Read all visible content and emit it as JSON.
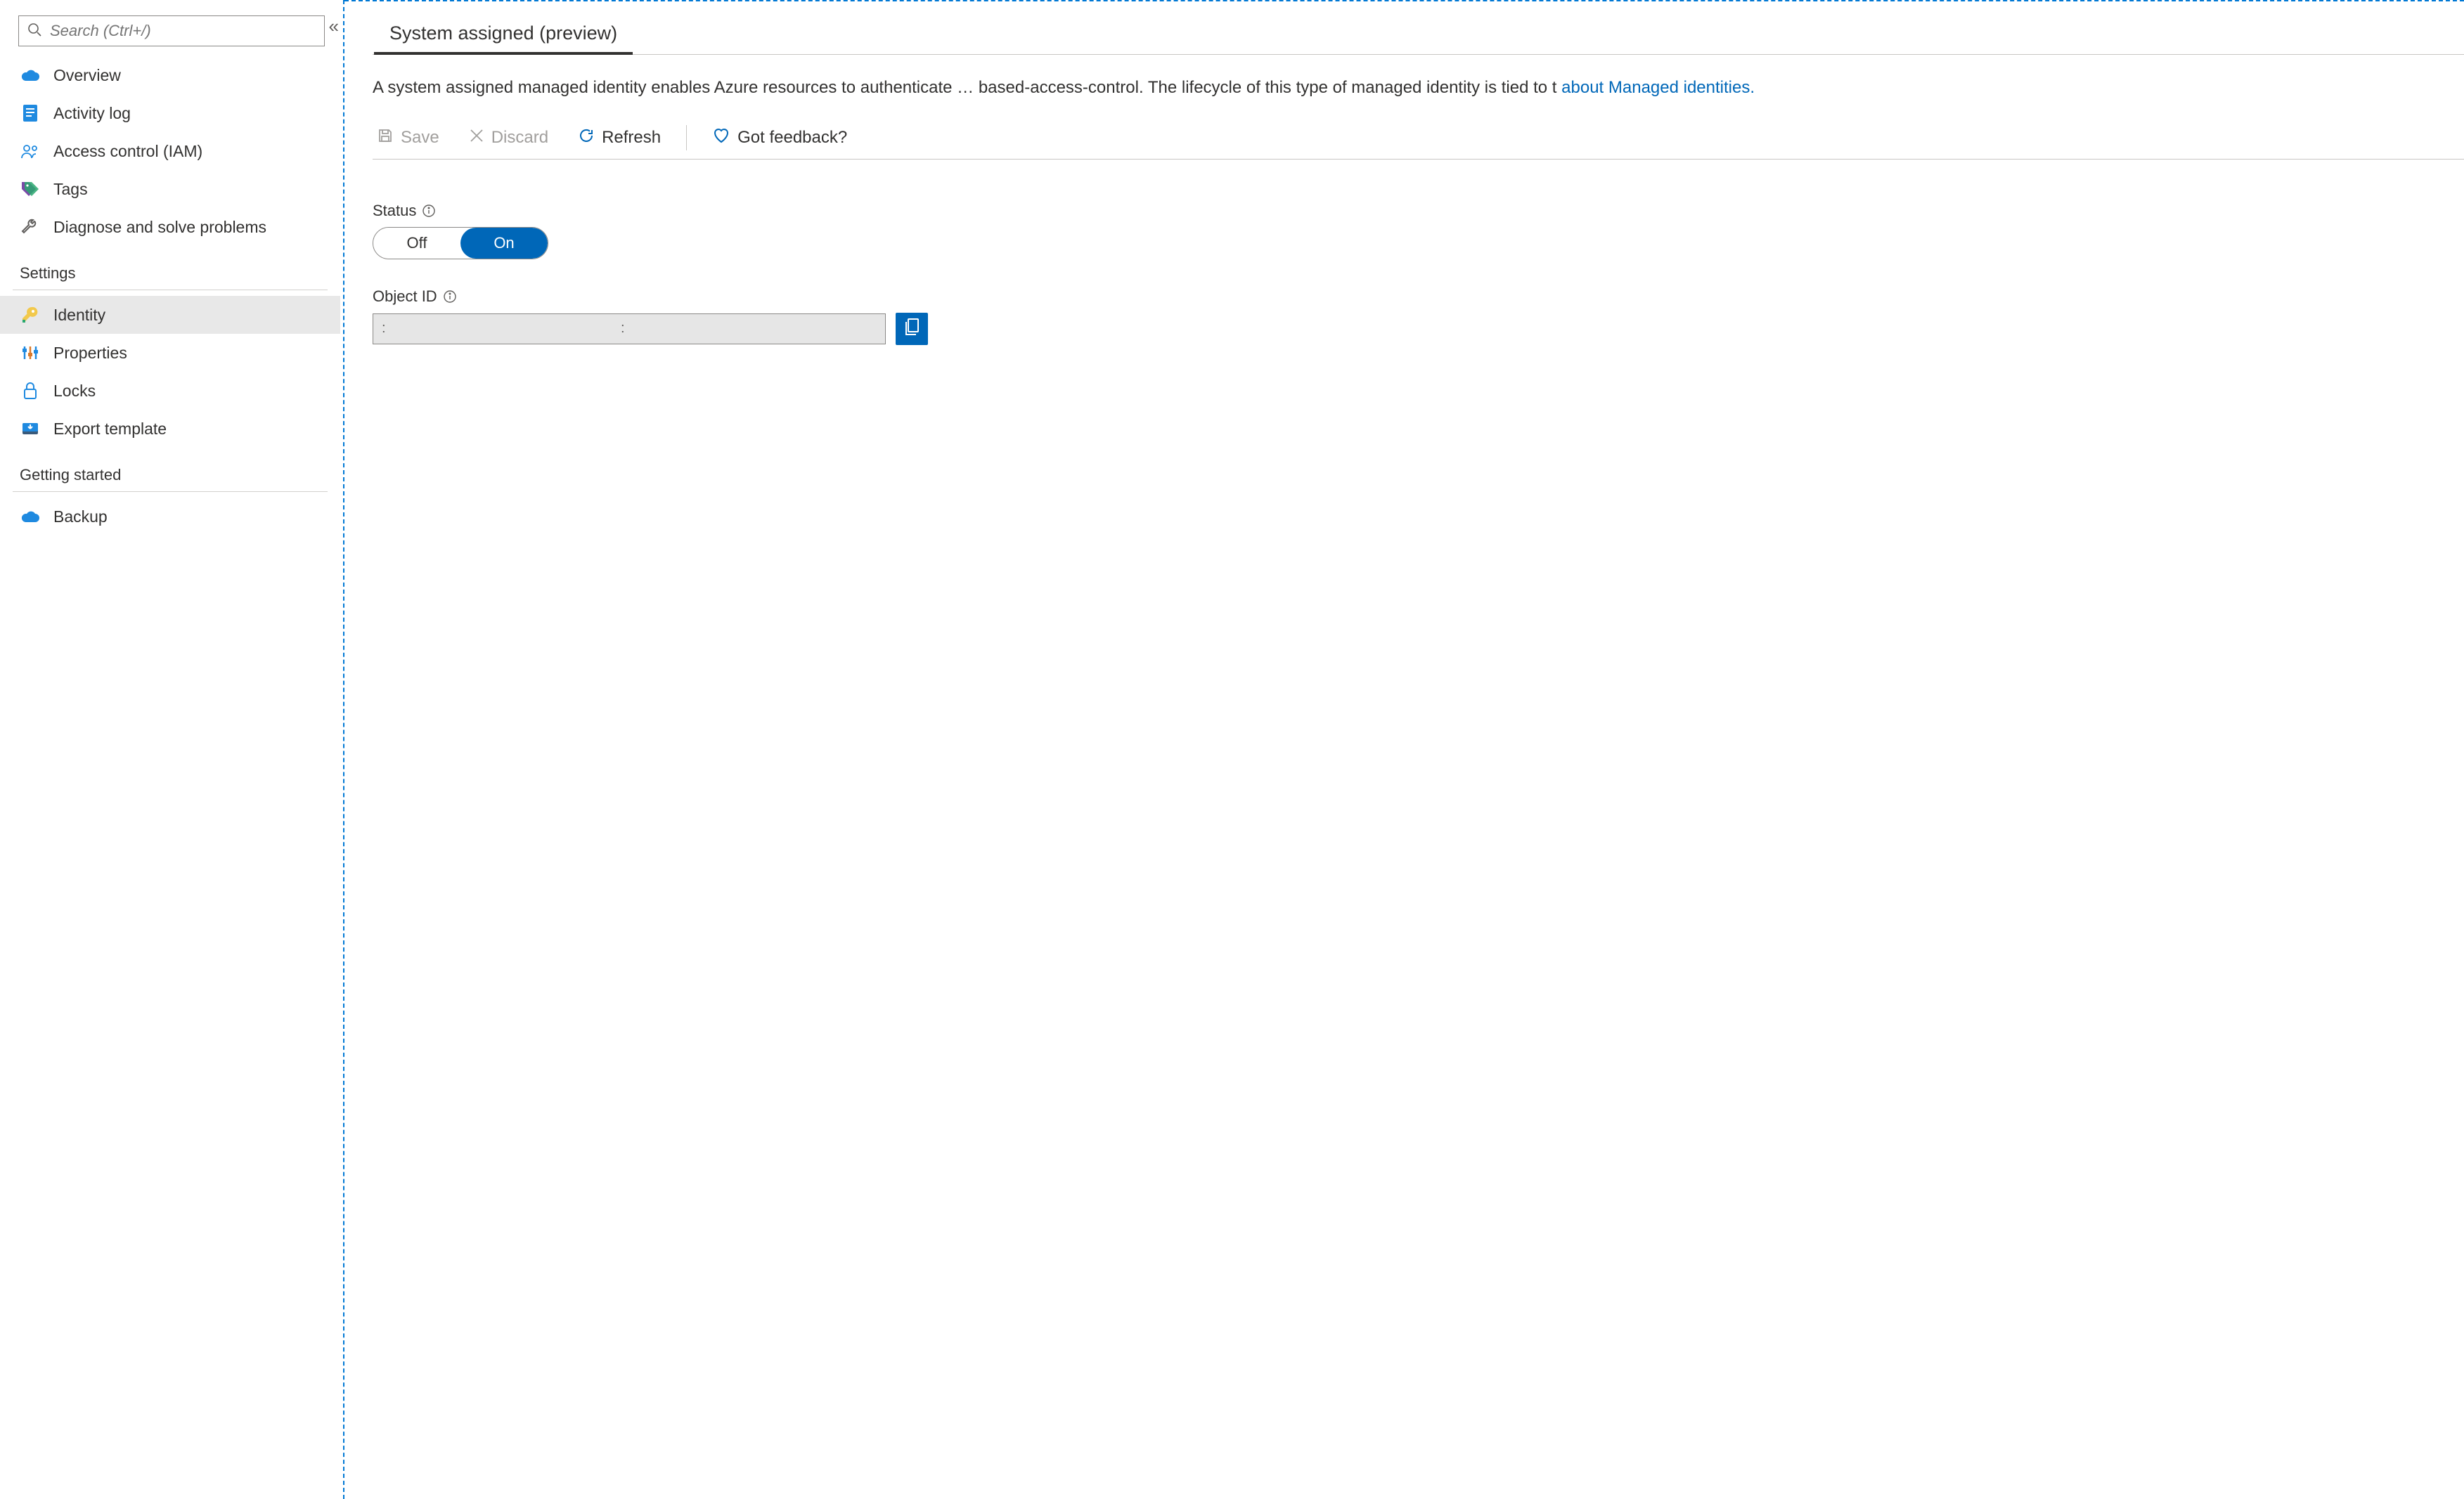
{
  "sidebar": {
    "search_placeholder": "Search (Ctrl+/)",
    "items_top": [
      {
        "icon": "cloud-icon",
        "label": "Overview"
      },
      {
        "icon": "log-icon",
        "label": "Activity log"
      },
      {
        "icon": "people-icon",
        "label": "Access control (IAM)"
      },
      {
        "icon": "tags-icon",
        "label": "Tags"
      },
      {
        "icon": "wrench-icon",
        "label": "Diagnose and solve problems"
      }
    ],
    "group_settings": "Settings",
    "items_settings": [
      {
        "icon": "key-icon",
        "label": "Identity",
        "selected": true
      },
      {
        "icon": "sliders-icon",
        "label": "Properties"
      },
      {
        "icon": "lock-icon",
        "label": "Locks"
      },
      {
        "icon": "export-icon",
        "label": "Export template"
      }
    ],
    "group_getting_started": "Getting started",
    "items_getting_started": [
      {
        "icon": "cloud-icon",
        "label": "Backup"
      }
    ]
  },
  "main": {
    "tab_label": "System assigned (preview)",
    "description_text": "A system assigned managed identity enables Azure resources to authenticate … based-access-control. The lifecycle of this type of managed identity is tied to t",
    "description_link": "about Managed identities.",
    "toolbar": {
      "save": "Save",
      "discard": "Discard",
      "refresh": "Refresh",
      "feedback": "Got feedback?"
    },
    "status_label": "Status",
    "status_off": "Off",
    "status_on": "On",
    "status_value": "On",
    "object_id_label": "Object ID",
    "object_id_value": ":                                            :"
  },
  "colors": {
    "accent": "#0067b8",
    "selection_dashed": "#0078d4"
  }
}
